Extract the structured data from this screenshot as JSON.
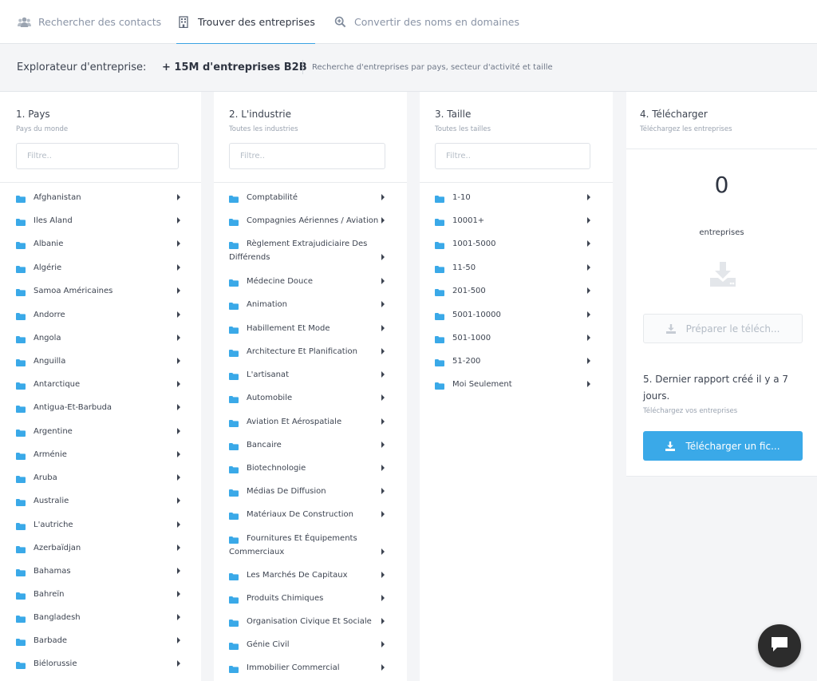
{
  "nav": {
    "tabs": [
      {
        "label": "Rechercher des contacts",
        "icon": "users-icon",
        "active": false
      },
      {
        "label": "Trouver des entreprises",
        "icon": "building-icon",
        "active": true
      },
      {
        "label": "Convertir des noms en domaines",
        "icon": "search-plus-icon",
        "active": false
      }
    ]
  },
  "subheader": {
    "label": "Explorateur d'entreprise:",
    "count": "+ 15M d'entreprises B2B",
    "description": "Recherche d'entreprises par pays, secteur d'activité et taille"
  },
  "countries": {
    "title": "1. Pays",
    "subtitle": "Pays du monde",
    "filter_placeholder": "Filtre..",
    "items": [
      "Afghanistan",
      "Iles Aland",
      "Albanie",
      "Algérie",
      "Samoa Américaines",
      "Andorre",
      "Angola",
      "Anguilla",
      "Antarctique",
      "Antigua-Et-Barbuda",
      "Argentine",
      "Arménie",
      "Aruba",
      "Australie",
      "L'autriche",
      "Azerbaïdjan",
      "Bahamas",
      "Bahreïn",
      "Bangladesh",
      "Barbade",
      "Biélorussie"
    ]
  },
  "industries": {
    "title": "2. L'industrie",
    "subtitle": "Toutes les industries",
    "filter_placeholder": "Filtre..",
    "items": [
      "Comptabilité",
      "Compagnies Aériennes / Aviation",
      "Règlement Extrajudiciaire Des Différends",
      "Médecine Douce",
      "Animation",
      "Habillement Et Mode",
      "Architecture Et Planification",
      "L'artisanat",
      "Automobile",
      "Aviation Et Aérospatiale",
      "Bancaire",
      "Biotechnologie",
      "Médias De Diffusion",
      "Matériaux De Construction",
      "Fournitures Et Équipements Commerciaux",
      "Les Marchés De Capitaux",
      "Produits Chimiques",
      "Organisation Civique Et Sociale",
      "Génie Civil",
      "Immobilier Commercial"
    ]
  },
  "sizes": {
    "title": "3. Taille",
    "subtitle": "Toutes les tailles",
    "filter_placeholder": "Filtre..",
    "items": [
      "1-10",
      "10001+",
      "1001-5000",
      "11-50",
      "201-500",
      "5001-10000",
      "501-1000",
      "51-200",
      "Moi Seulement"
    ]
  },
  "download": {
    "title": "4. Télécharger",
    "subtitle": "Téléchargez les entreprises",
    "count": "0",
    "count_label": "entreprises",
    "prepare_button": "Préparer le téléch...",
    "last_report_title": "5. Dernier rapport créé il y a 7 jours.",
    "last_report_subtitle": "Téléchargez vos entreprises",
    "download_button": "Télécharger un fic..."
  },
  "colors": {
    "accent": "#3aa3e3",
    "folder": "#3aa9e8",
    "button": "#3aa9e8",
    "text": "#3d4451",
    "muted": "#9aa3b0"
  }
}
